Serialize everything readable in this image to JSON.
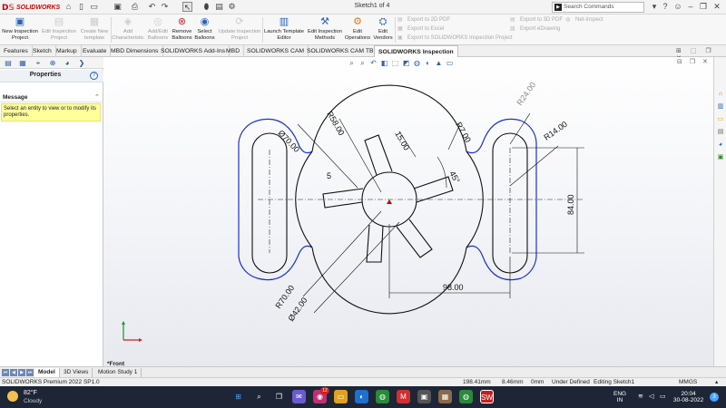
{
  "app": {
    "logo_text": "SOLIDWORKS",
    "document_title": "Sketch1 of 4"
  },
  "search": {
    "placeholder": "Search Commands"
  },
  "ribbon": {
    "buttons": [
      {
        "label": "New Inspection Project",
        "enabled": true
      },
      {
        "label": "Edit Inspection Project",
        "enabled": false
      },
      {
        "label": "Create New template",
        "enabled": false
      },
      {
        "label": "Add Characteristic",
        "enabled": false
      },
      {
        "label": "Add/Edit Balloons",
        "enabled": false
      },
      {
        "label": "Remove Balloons",
        "enabled": true
      },
      {
        "label": "Select Balloons",
        "enabled": true
      },
      {
        "label": "Update Inspection Project",
        "enabled": false
      },
      {
        "label": "Launch Template Editor",
        "enabled": true
      },
      {
        "label": "Edit Inspection Methods",
        "enabled": true
      },
      {
        "label": "Edit Operations",
        "enabled": true
      },
      {
        "label": "Edit Vendors",
        "enabled": true
      }
    ],
    "export_group": [
      "Export to 2D PDF",
      "Export to Excel",
      "Export to SOLIDWORKS Inspection Project"
    ],
    "export_group2": [
      "Export to 3D PDF",
      "Export eDrawing"
    ],
    "net_inspect": "Net-Inspect"
  },
  "tabs": [
    "Features",
    "Sketch",
    "Markup",
    "Evaluate",
    "MBD Dimensions",
    "SOLIDWORKS Add-Ins",
    "MBD",
    "SOLIDWORKS CAM",
    "SOLIDWORKS CAM TBM",
    "SOLIDWORKS Inspection"
  ],
  "active_tab": "SOLIDWORKS Inspection",
  "properties": {
    "title": "Properties",
    "help": "?",
    "message_label": "Message",
    "message_text": "Select an entity to view or to modify its properties."
  },
  "drawing": {
    "dimensions": {
      "d70": "Ø70.00",
      "r58": "R58.00",
      "d15": "15.00",
      "r7": "R7.00",
      "ang45": "45°",
      "r24": "R24.00",
      "r14": "R14.00",
      "v84": "84.00",
      "h98": "98.00",
      "r70": "R70.00",
      "d42": "Ø42.00",
      "count5": "5"
    }
  },
  "view_name": "*Front",
  "bottom_tabs": [
    "Model",
    "3D Views",
    "Motion Study 1"
  ],
  "status": {
    "product": "SOLIDWORKS Premium 2022 SP1.0",
    "x": "198.41mm",
    "y": "8.46mm",
    "z": "0mm",
    "state": "Under Defined",
    "editing": "Editing Sketch1",
    "units": "MMGS"
  },
  "taskbar": {
    "temperature": "82°F",
    "condition": "Cloudy",
    "language": "ENG",
    "region": "IN",
    "time": "20:04",
    "date": "30-08-2022",
    "notifications": "3",
    "badge": "12"
  }
}
